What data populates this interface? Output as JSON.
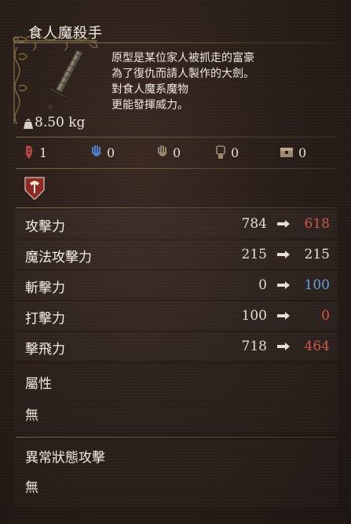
{
  "item": {
    "name": "食人魔殺手",
    "weight": "8.50 kg",
    "description": [
      "原型是某位家人被抓走的富豪",
      "為了復仇而請人製作的大劍。",
      "對食人魔系魔物",
      "更能發揮威力。"
    ]
  },
  "upgrades": [
    {
      "icon": "red-seal-icon",
      "value": "1",
      "color": "#c85a5a"
    },
    {
      "icon": "blue-hand-icon",
      "value": "0",
      "color": "#4f7fc8"
    },
    {
      "icon": "hand-icon",
      "value": "0",
      "color": "#9a8a70"
    },
    {
      "icon": "gauntlet-icon",
      "value": "0",
      "color": "#9a8a70"
    },
    {
      "icon": "chest-icon",
      "value": "0",
      "color": "#9a8a70"
    }
  ],
  "stats": [
    {
      "label": "攻擊力",
      "base": "784",
      "new": "618",
      "new_color": "#d2554a"
    },
    {
      "label": "魔法攻擊力",
      "base": "215",
      "new": "215",
      "new_color": "#e8e0d4"
    },
    {
      "label": "斬擊力",
      "base": "0",
      "new": "100",
      "new_color": "#6f9be0"
    },
    {
      "label": "打擊力",
      "base": "100",
      "new": "0",
      "new_color": "#d2554a"
    },
    {
      "label": "擊飛力",
      "base": "718",
      "new": "464",
      "new_color": "#d2554a"
    }
  ],
  "attribute": {
    "label": "屬性",
    "value": "無"
  },
  "status_attack": {
    "label": "異常狀態攻擊",
    "value": "無"
  },
  "colors": {
    "accent_down": "#d2554a",
    "accent_up": "#6f9be0"
  }
}
